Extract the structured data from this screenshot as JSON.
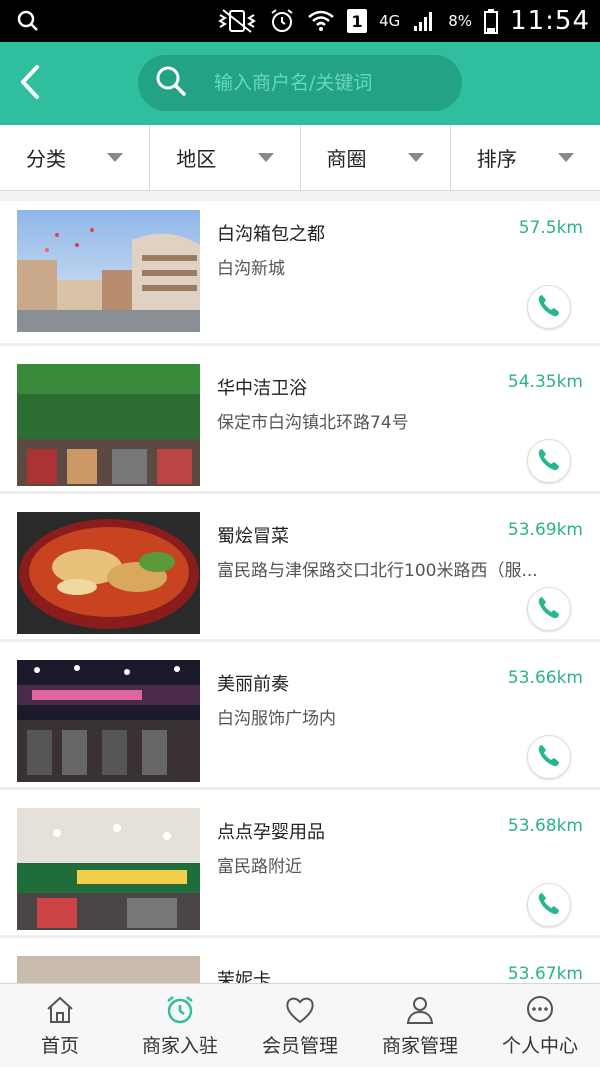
{
  "status_bar": {
    "network": "4G",
    "battery": "8%",
    "time": "11:54",
    "sim": "1"
  },
  "header": {
    "search_placeholder": "输入商户名/关键词"
  },
  "filters": [
    {
      "label": "分类"
    },
    {
      "label": "地区"
    },
    {
      "label": "商圈"
    },
    {
      "label": "排序"
    }
  ],
  "merchants": [
    {
      "name": "白沟箱包之都",
      "address": "白沟新城",
      "distance": "57.5km",
      "image": "mall-building-photo"
    },
    {
      "name": "华中洁卫浴",
      "address": "保定市白沟镇北环路74号",
      "distance": "54.35km",
      "image": "storefront-sign-photo"
    },
    {
      "name": "蜀烩冒菜",
      "address": "富民路与津保路交口北行100米路西（服...",
      "distance": "53.69km",
      "image": "noodle-bowl-photo"
    },
    {
      "name": "美丽前奏",
      "address": "白沟服饰广场内",
      "distance": "53.66km",
      "image": "night-store-photo"
    },
    {
      "name": "点点孕婴用品",
      "address": "富民路附近",
      "distance": "53.68km",
      "image": "baby-store-photo"
    },
    {
      "name": "茉妮卡",
      "address": "",
      "distance": "53.67km",
      "image": "store-photo"
    }
  ],
  "bottom_nav": [
    {
      "label": "首页",
      "icon": "home-icon"
    },
    {
      "label": "商家入驻",
      "icon": "alarm-clock-icon"
    },
    {
      "label": "会员管理",
      "icon": "heart-icon"
    },
    {
      "label": "商家管理",
      "icon": "user-icon"
    },
    {
      "label": "个人中心",
      "icon": "chat-bubble-icon"
    }
  ],
  "colors": {
    "accent": "#2fbf9f",
    "search_bg": "#23a286",
    "distance": "#2ab28f"
  }
}
